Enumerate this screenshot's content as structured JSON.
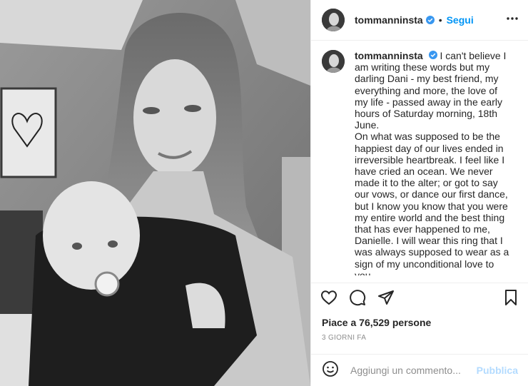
{
  "header": {
    "username": "tommanninsta",
    "dot": "•",
    "follow_label": "Segui",
    "more_icon": "more-horizontal-icon"
  },
  "caption": {
    "username": "tommanninsta",
    "text": "I can't believe I am writing these words but my darling Dani - my best friend, my everything and more, the love of my life - passed away in the early hours of Saturday morning, 18th June.\nOn what was supposed to be the happiest day of our lives ended in irreversible heartbreak. I feel like I have cried an ocean. We never made it to the alter; or got to say our vows, or dance our first dance, but I know you know that you were my entire world and the best thing that has ever happened to me, Danielle. I will wear this ring that I was always supposed to wear as a sign of my unconditional love to you.\nI am completely broken trying to process this and I honestly don't"
  },
  "actions": {
    "like_icon": "heart-icon",
    "comment_icon": "comment-icon",
    "share_icon": "paper-plane-icon",
    "save_icon": "bookmark-icon"
  },
  "likes": "Piace a 76,529 persone",
  "timestamp": "3 GIORNI FA",
  "comment_box": {
    "emoji_icon": "smiley-icon",
    "placeholder": "Aggiungi un commento...",
    "publish_label": "Pubblica"
  },
  "colors": {
    "link_blue": "#0095f6",
    "publish_disabled": "#b3dbff",
    "verified_blue": "#3897f0"
  }
}
